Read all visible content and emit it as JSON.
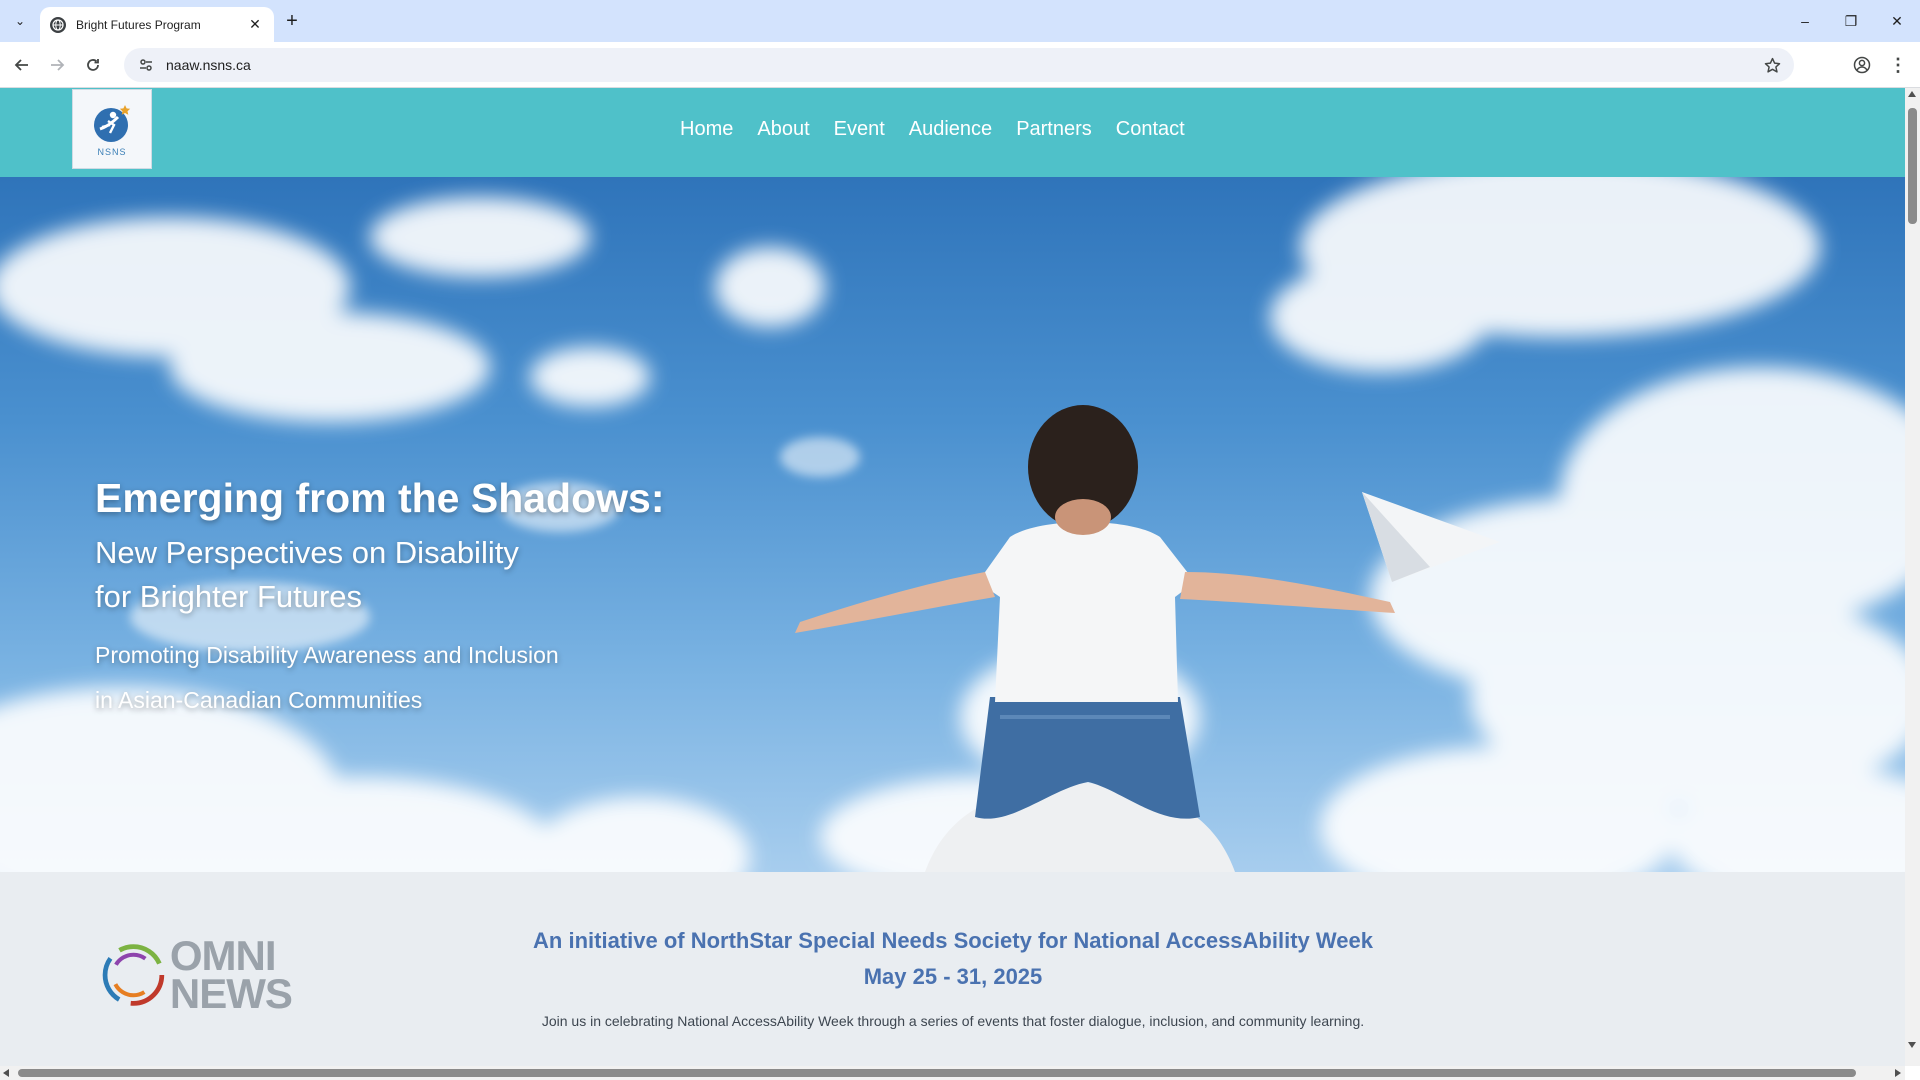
{
  "browser": {
    "tab_title": "Bright Futures Program",
    "tab_close_icon": "close-icon",
    "new_tab_icon": "plus-icon",
    "url": "naaw.nsns.ca",
    "window_controls": [
      "minimize-icon",
      "restore-icon",
      "close-icon"
    ]
  },
  "site": {
    "logo_text": "NSNS",
    "nav": [
      "Home",
      "About",
      "Event",
      "Audience",
      "Partners",
      "Contact"
    ]
  },
  "hero": {
    "title": "Emerging from the Shadows:",
    "subtitle": "New Perspectives on Disability\nfor Brighter Futures",
    "tagline": "Promoting Disability Awareness and Inclusion\nin Asian-Canadian Communities"
  },
  "intro": {
    "watermark": "OMNI NEWS",
    "heading": "An initiative of NorthStar Special Needs Society for National AccessAbility Week",
    "dates": "May 25 - 31, 2025",
    "body": "Join us in celebrating National AccessAbility Week through a series of events that foster dialogue, inclusion, and community learning."
  },
  "colors": {
    "header_bg": "#4fc1c9",
    "heading_blue": "#4a72b0",
    "tabstrip_bg": "#d3e3fd"
  }
}
